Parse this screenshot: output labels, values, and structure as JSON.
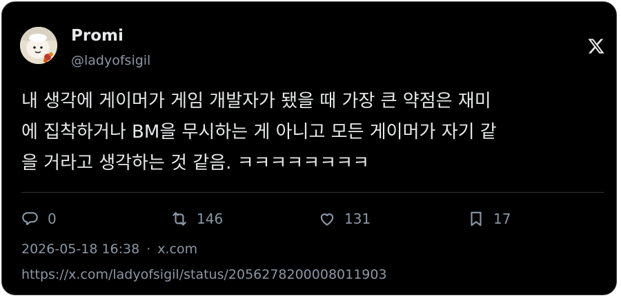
{
  "author": {
    "display_name": "Promi",
    "handle": "@ladyofsigil",
    "avatar_icon": "avatar-image"
  },
  "brand_icon": "x-logo-icon",
  "tweet": {
    "lines": [
      "내 생각에 게이머가 게임 개발자가 됐을 때 가장 큰 약점은 재미",
      "에 집착하거나 BM을 무시하는 게 아니고 모든 게이머가 자기 같",
      "을 거라고 생각하는 것 같음. ㅋㅋㅋㅋㅋㅋㅋㅋ"
    ]
  },
  "actions": {
    "reply": {
      "icon": "reply-icon",
      "count": "0"
    },
    "repost": {
      "icon": "repost-icon",
      "count": "146"
    },
    "like": {
      "icon": "heart-icon",
      "count": "131"
    },
    "bookmark": {
      "icon": "bookmark-icon",
      "count": "17"
    }
  },
  "meta": {
    "timestamp": "2026-05-18 16:38",
    "separator": "·",
    "source": "x.com"
  },
  "url": "https://x.com/ladyofsigil/status/2056278200008011903",
  "colors": {
    "background": "#000000",
    "text": "#e7e9ea",
    "muted": "#8b98a5",
    "border": "#2f3336"
  }
}
